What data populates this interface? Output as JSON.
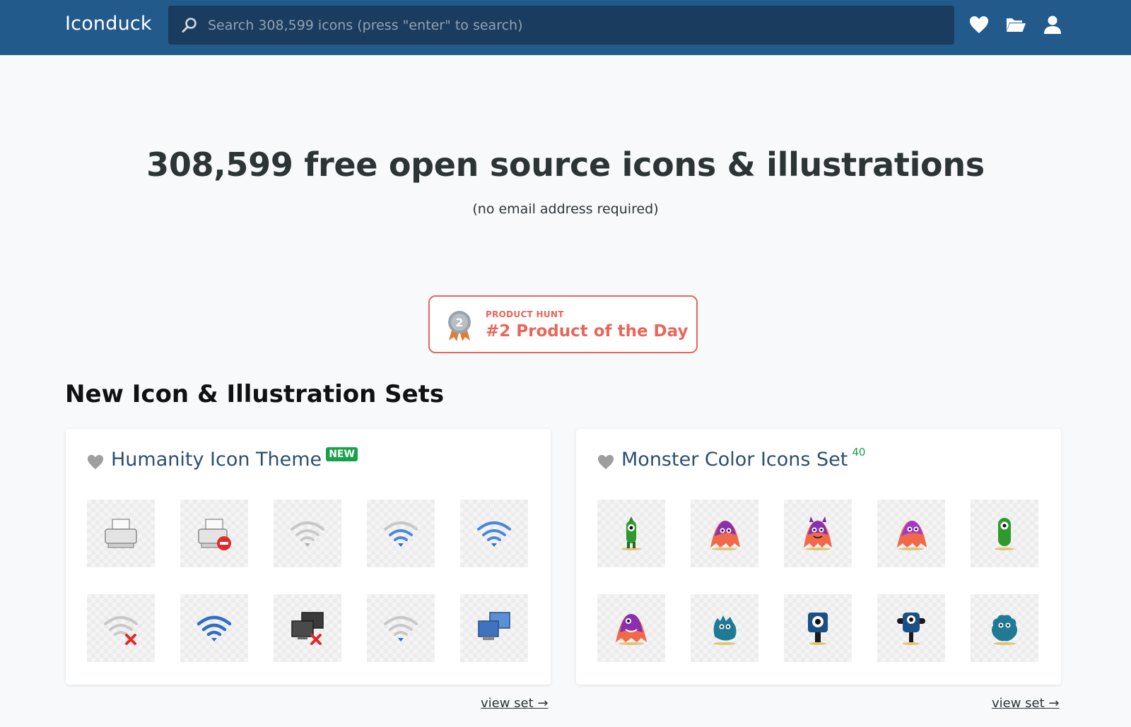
{
  "header": {
    "brand": "Iconduck",
    "search_placeholder": "Search 308,599 icons (press \"enter\" to search)",
    "icons": [
      "heart-icon",
      "folder-open-icon",
      "user-icon"
    ]
  },
  "hero": {
    "title": "308,599 free open source icons & illustrations",
    "subtitle": "(no email address required)"
  },
  "product_hunt": {
    "label_small": "PRODUCT HUNT",
    "label_big": "#2 Product of the Day",
    "medal_number": "2"
  },
  "section": {
    "title": "New Icon & Illustration Sets"
  },
  "sets": [
    {
      "title": "Humanity Icon Theme",
      "badge": "NEW",
      "view_label": "view set →",
      "icons": [
        "printer-icon",
        "printer-error-icon",
        "wifi-weak-icon",
        "wifi-medium-icon",
        "wifi-strong-icon",
        "wifi-disconnected-icon",
        "wifi-full-icon",
        "network-offline-icon",
        "wifi-low-icon",
        "network-computers-icon"
      ]
    },
    {
      "title": "Monster Color Icons Set",
      "count": "40",
      "view_label": "view set →",
      "icons": [
        "monster-green-tall-icon",
        "monster-pink-ghost-icon",
        "monster-horned-icon",
        "monster-purple-ghost-icon",
        "monster-green-cyclops-icon",
        "monster-pink-purple-icon",
        "monster-teal-blob-icon",
        "monster-blue-cyclops-icon",
        "monster-blue-eye-icon",
        "monster-teal-fluffy-icon"
      ]
    }
  ],
  "colors": {
    "header_bg": "#235a8c",
    "search_bg": "#1a3d5f",
    "accent_red": "#e8665a",
    "accent_green": "#14a348"
  }
}
